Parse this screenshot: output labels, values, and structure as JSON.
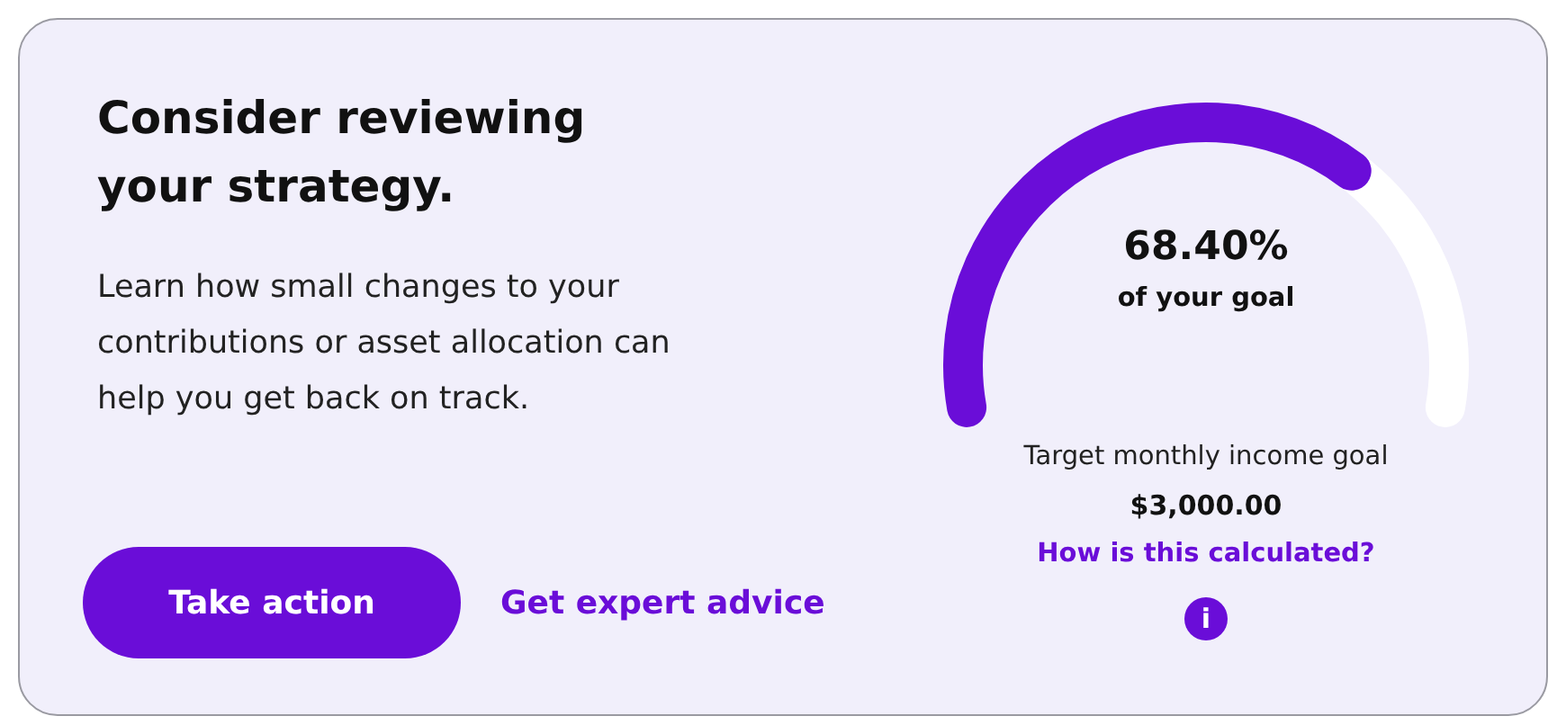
{
  "card": {
    "title": "Consider reviewing your strategy.",
    "description": "Learn how small changes to your contributions or asset allocation can help you get back on track.",
    "primary_button": "Take action",
    "secondary_link": "Get expert advice"
  },
  "goal": {
    "percent": "68.40%",
    "caption": "of your goal",
    "target_label": "Target monthly income goal",
    "target_value": "$3,000.00",
    "help_link": "How is this calculated?",
    "info_icon": "i"
  }
}
